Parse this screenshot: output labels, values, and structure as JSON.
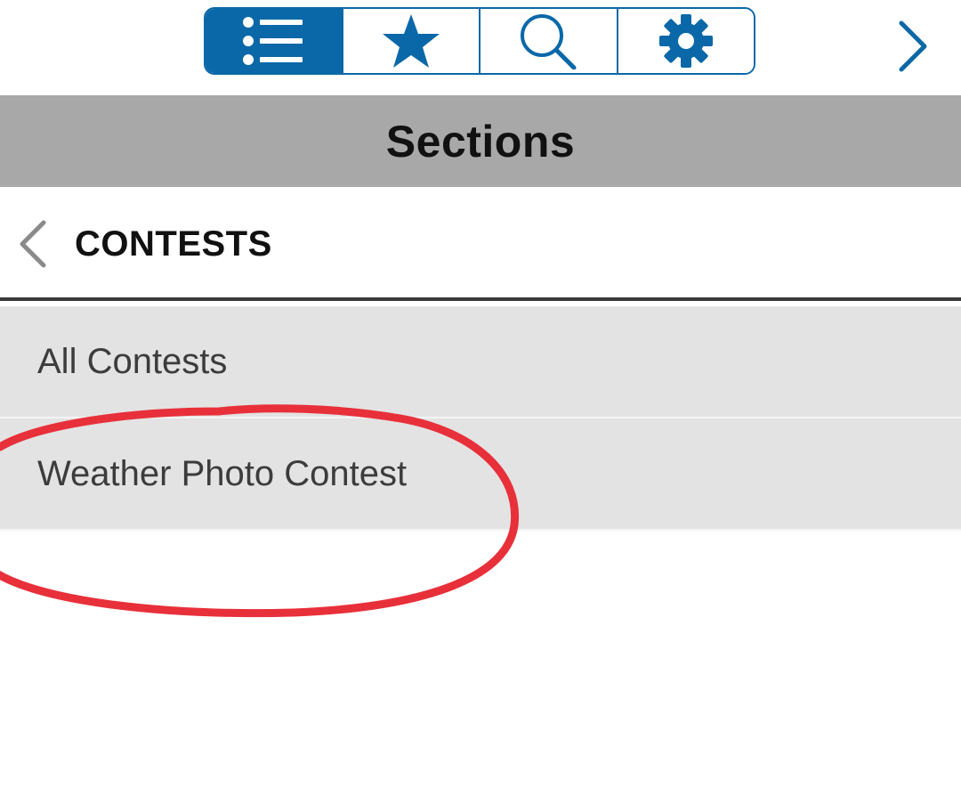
{
  "toolbar": {
    "tabs": [
      {
        "icon": "list-icon",
        "active": true
      },
      {
        "icon": "star-icon",
        "active": false
      },
      {
        "icon": "search-icon",
        "active": false
      },
      {
        "icon": "gear-icon",
        "active": false
      }
    ],
    "next_icon": "chevron-right-icon"
  },
  "header": {
    "title": "Sections"
  },
  "category": {
    "back_icon": "chevron-left-icon",
    "title": "CONTESTS"
  },
  "list": {
    "items": [
      {
        "label": "All Contests"
      },
      {
        "label": "Weather Photo Contest"
      }
    ]
  },
  "annotation": {
    "type": "hand-drawn-circle",
    "color": "#e8303a",
    "highlights": "Weather Photo Contest"
  },
  "colors": {
    "accent": "#0a68a8",
    "header_bg": "#a8a8a8",
    "list_bg": "#e3e3e3",
    "annotation": "#e8303a"
  }
}
